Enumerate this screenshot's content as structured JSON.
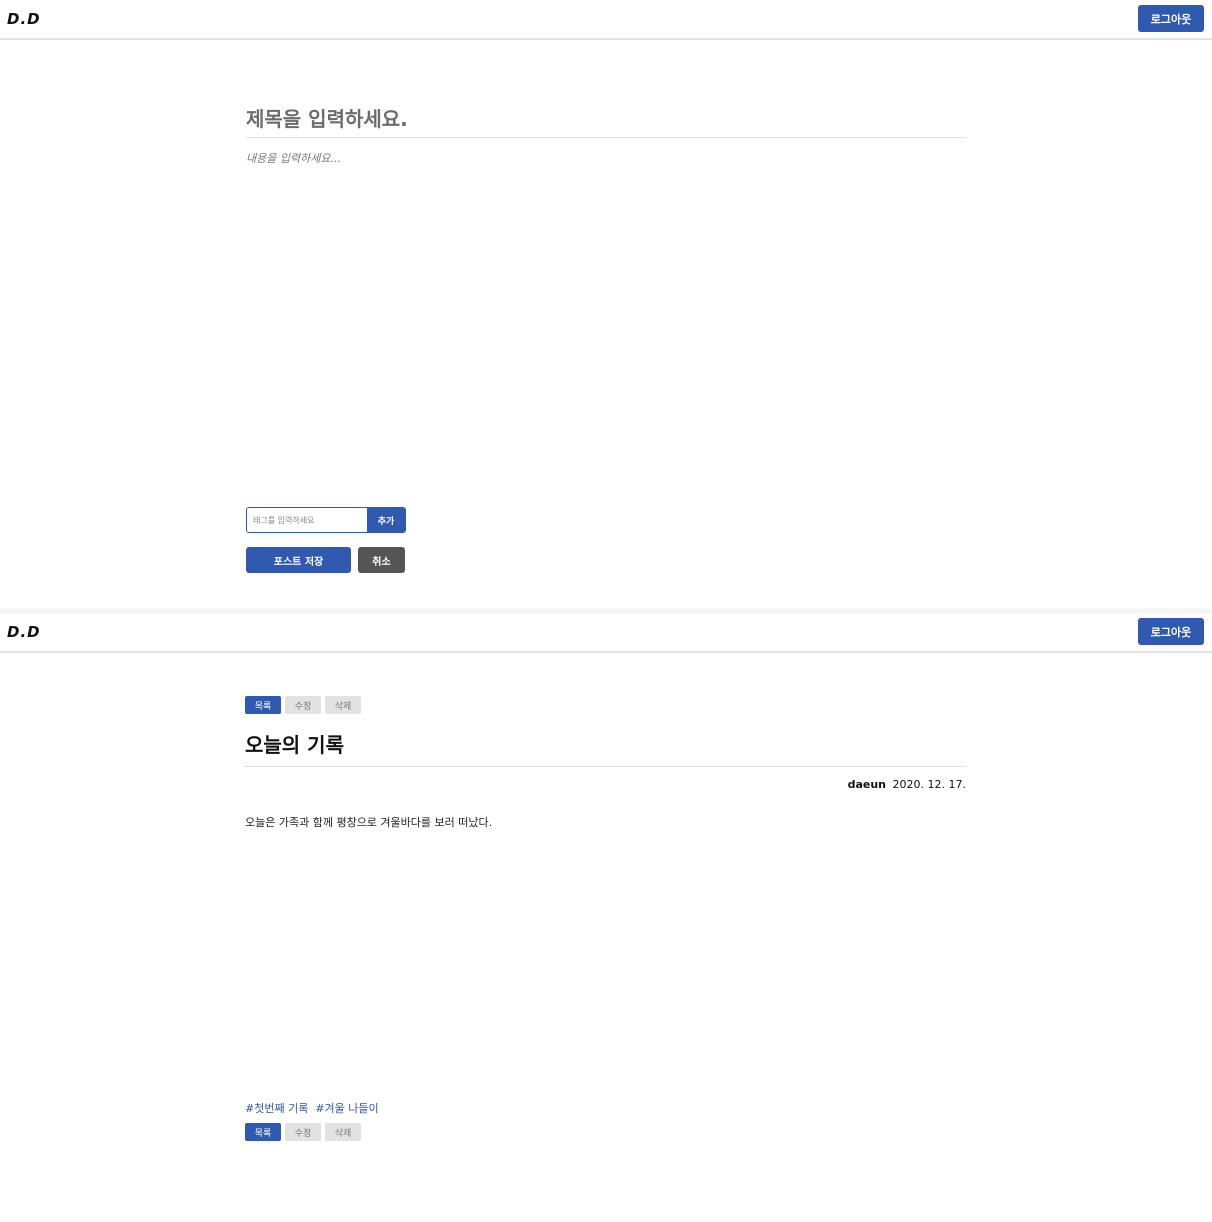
{
  "editor": {
    "header": {
      "logo": "D.D",
      "logout_label": "로그아웃"
    },
    "title_placeholder": "제목을 입력하세요.",
    "content_placeholder": "내용을 입력하세요...",
    "tag_placeholder": "태그를 입력하세요",
    "tag_add_label": "추가",
    "save_label": "포스트 저장",
    "cancel_label": "취소"
  },
  "post": {
    "header": {
      "logo": "D.D",
      "logout_label": "로그아웃"
    },
    "actions": {
      "list_label": "목록",
      "edit_label": "수정",
      "delete_label": "삭제"
    },
    "title": "오늘의 기록",
    "author": "daeun",
    "date": "2020. 12. 17.",
    "body": "오늘은 가족과 함께 평창으로 겨울바다를 보러 떠났다.",
    "tags": [
      "#첫번째 기록",
      "#겨울 나들이"
    ]
  },
  "colors": {
    "accent": "#3059b0",
    "cancel": "#555555",
    "muted_button": "#e2e2e2"
  }
}
